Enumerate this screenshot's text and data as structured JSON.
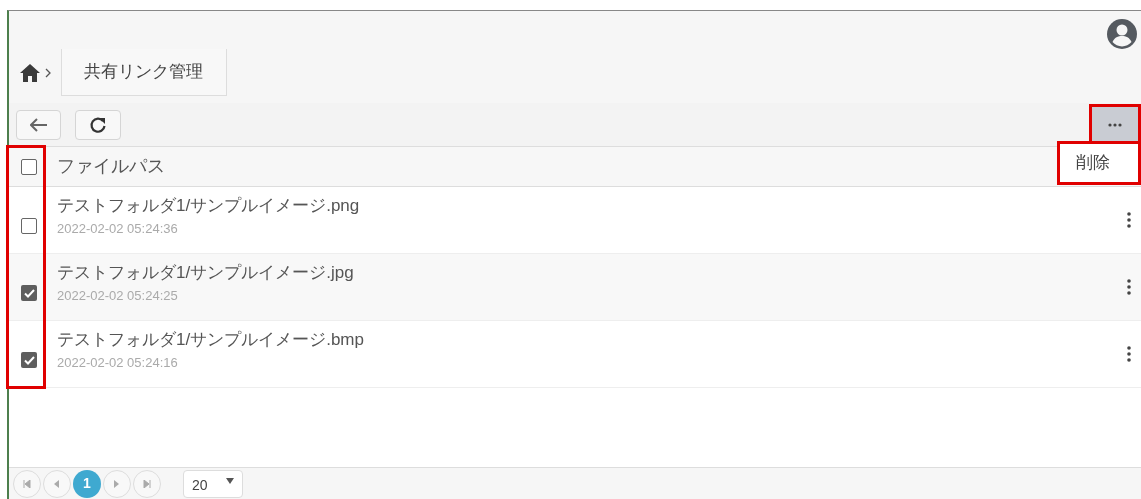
{
  "breadcrumb": {
    "current": "共有リンク管理"
  },
  "toolbar": {
    "more_highlighted": true
  },
  "menu": {
    "highlighted": true,
    "items": [
      "削除"
    ]
  },
  "table": {
    "select_all": {
      "checked": false
    },
    "column_highlighted": true,
    "columns": [
      "ファイルパス"
    ],
    "rows": [
      {
        "path": "テストフォルダ1/サンプルイメージ.png",
        "date": "2022-02-02 05:24:36",
        "checked": false
      },
      {
        "path": "テストフォルダ1/サンプルイメージ.jpg",
        "date": "2022-02-02 05:24:25",
        "checked": true
      },
      {
        "path": "テストフォルダ1/サンプルイメージ.bmp",
        "date": "2022-02-02 05:24:16",
        "checked": true
      }
    ]
  },
  "pager": {
    "pages": [
      {
        "label": "1",
        "selected": true
      }
    ],
    "page_size": "20"
  }
}
